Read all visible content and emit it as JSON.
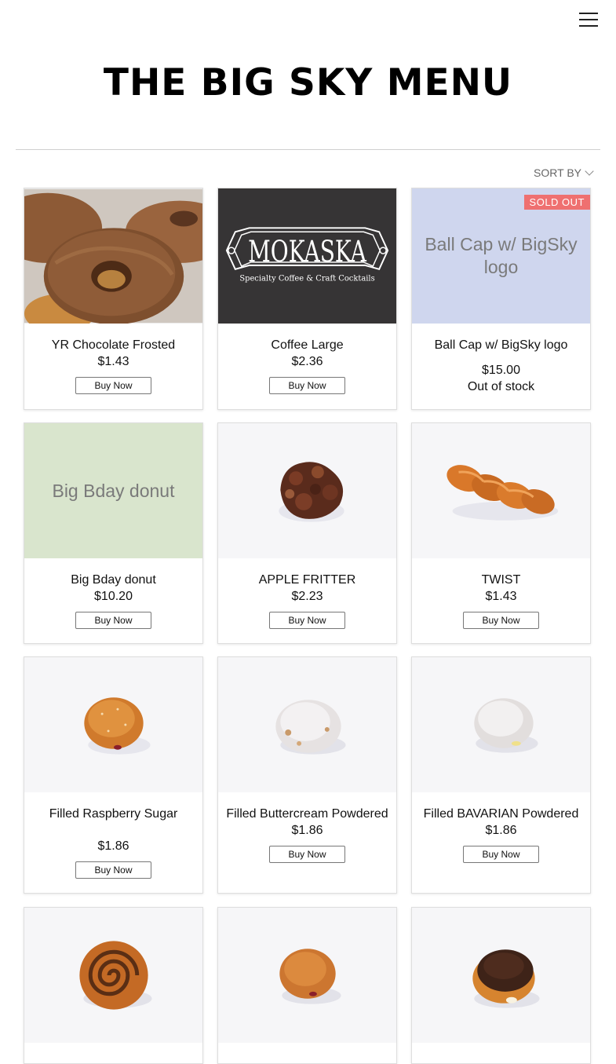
{
  "header": {
    "menu_icon": "hamburger-menu-icon",
    "title": "THE BIG SKY MENU"
  },
  "sort": {
    "label": "SORT BY"
  },
  "products": [
    {
      "name": "YR Chocolate Frosted",
      "price": "$1.43",
      "button": "Buy Now"
    },
    {
      "name": "Coffee Large",
      "price": "$2.36",
      "button": "Buy Now",
      "logo_text": "MOKASKA",
      "logo_subtext": "Specialty Coffee & Craft Cocktails"
    },
    {
      "name": "Ball Cap w/ BigSky logo",
      "price": "$15.00",
      "stock": "Out of stock",
      "badge": "SOLD OUT",
      "placeholder": "Ball Cap w/ BigSky logo"
    },
    {
      "name": "Big Bday donut",
      "price": "$10.20",
      "button": "Buy Now",
      "placeholder": "Big Bday donut"
    },
    {
      "name": "APPLE FRITTER",
      "price": "$2.23",
      "button": "Buy Now"
    },
    {
      "name": "TWIST",
      "price": "$1.43",
      "button": "Buy Now"
    },
    {
      "name": "Filled Raspberry Sugar",
      "price": "$1.86",
      "button": "Buy Now"
    },
    {
      "name": "Filled Buttercream Powdered",
      "price": "$1.86",
      "button": "Buy Now"
    },
    {
      "name": "Filled BAVARIAN Powdered",
      "price": "$1.86",
      "button": "Buy Now"
    }
  ],
  "colors": {
    "sold_badge": "#ef7070",
    "ballcap_placeholder": "#cfd6ee",
    "bday_placeholder": "#d9e5cd",
    "coffee_bg": "#363435"
  }
}
